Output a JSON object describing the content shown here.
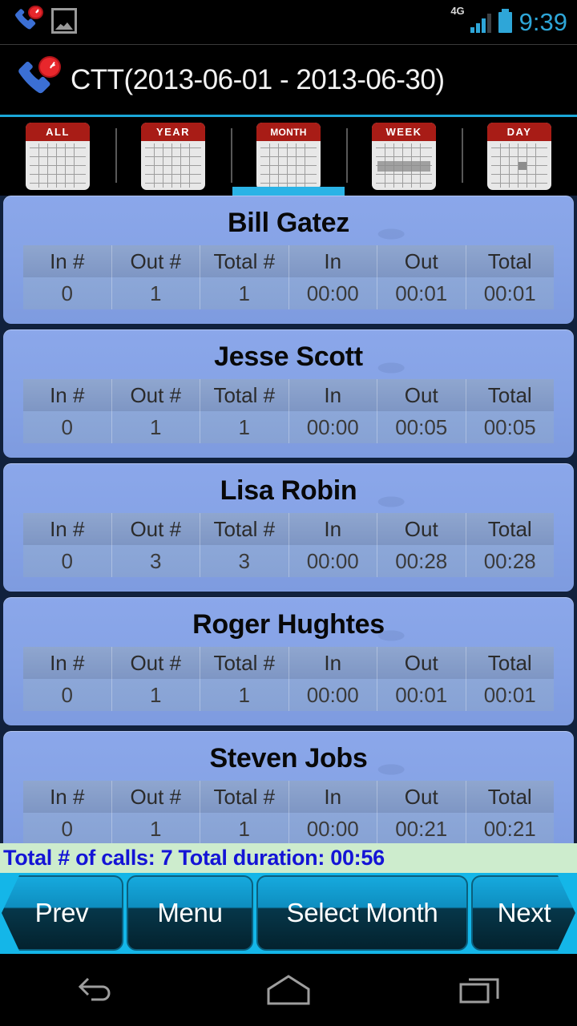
{
  "statusbar": {
    "icons": [
      "missed-call-icon",
      "photo-icon"
    ],
    "network_label": "4G",
    "clock": "9:39"
  },
  "titlebar": {
    "app_icon": "phone-clock-icon",
    "title": "CTT(2013-06-01 - 2013-06-30)"
  },
  "tabs": [
    {
      "label": "ALL",
      "icon": "calendar-all-icon",
      "selected": false
    },
    {
      "label": "YEAR",
      "icon": "calendar-year-icon",
      "selected": false
    },
    {
      "label": "MONTH",
      "icon": "calendar-month-icon",
      "selected": true
    },
    {
      "label": "WEEK",
      "icon": "calendar-week-icon",
      "selected": false
    },
    {
      "label": "DAY",
      "icon": "calendar-day-icon",
      "selected": false
    }
  ],
  "table": {
    "columns": [
      "In #",
      "Out #",
      "Total #",
      "In",
      "Out",
      "Total"
    ]
  },
  "contacts": [
    {
      "name": "Bill Gatez",
      "values": [
        "0",
        "1",
        "1",
        "00:00",
        "00:01",
        "00:01"
      ]
    },
    {
      "name": "Jesse Scott",
      "values": [
        "0",
        "1",
        "1",
        "00:00",
        "00:05",
        "00:05"
      ]
    },
    {
      "name": "Lisa Robin",
      "values": [
        "0",
        "3",
        "3",
        "00:00",
        "00:28",
        "00:28"
      ]
    },
    {
      "name": "Roger Hughtes",
      "values": [
        "0",
        "1",
        "1",
        "00:00",
        "00:01",
        "00:01"
      ]
    },
    {
      "name": "Steven Jobs",
      "values": [
        "0",
        "1",
        "1",
        "00:00",
        "00:21",
        "00:21"
      ]
    }
  ],
  "summary": {
    "text": "Total # of calls: 7 Total duration: 00:56",
    "total_calls": 7,
    "total_duration": "00:56",
    "text_color": "#1414d6",
    "background_color": "#cdeccd"
  },
  "buttons": {
    "prev": "Prev",
    "menu": "Menu",
    "select": "Select Month",
    "next": "Next"
  },
  "navbar": {
    "back": "back-icon",
    "home": "home-icon",
    "recents": "recents-icon"
  },
  "colors": {
    "accent_cyan": "#14b6e8",
    "card_blue": "#86a3e6",
    "list_background": "#11213c",
    "tab_indicator": "#2ab3e6"
  }
}
